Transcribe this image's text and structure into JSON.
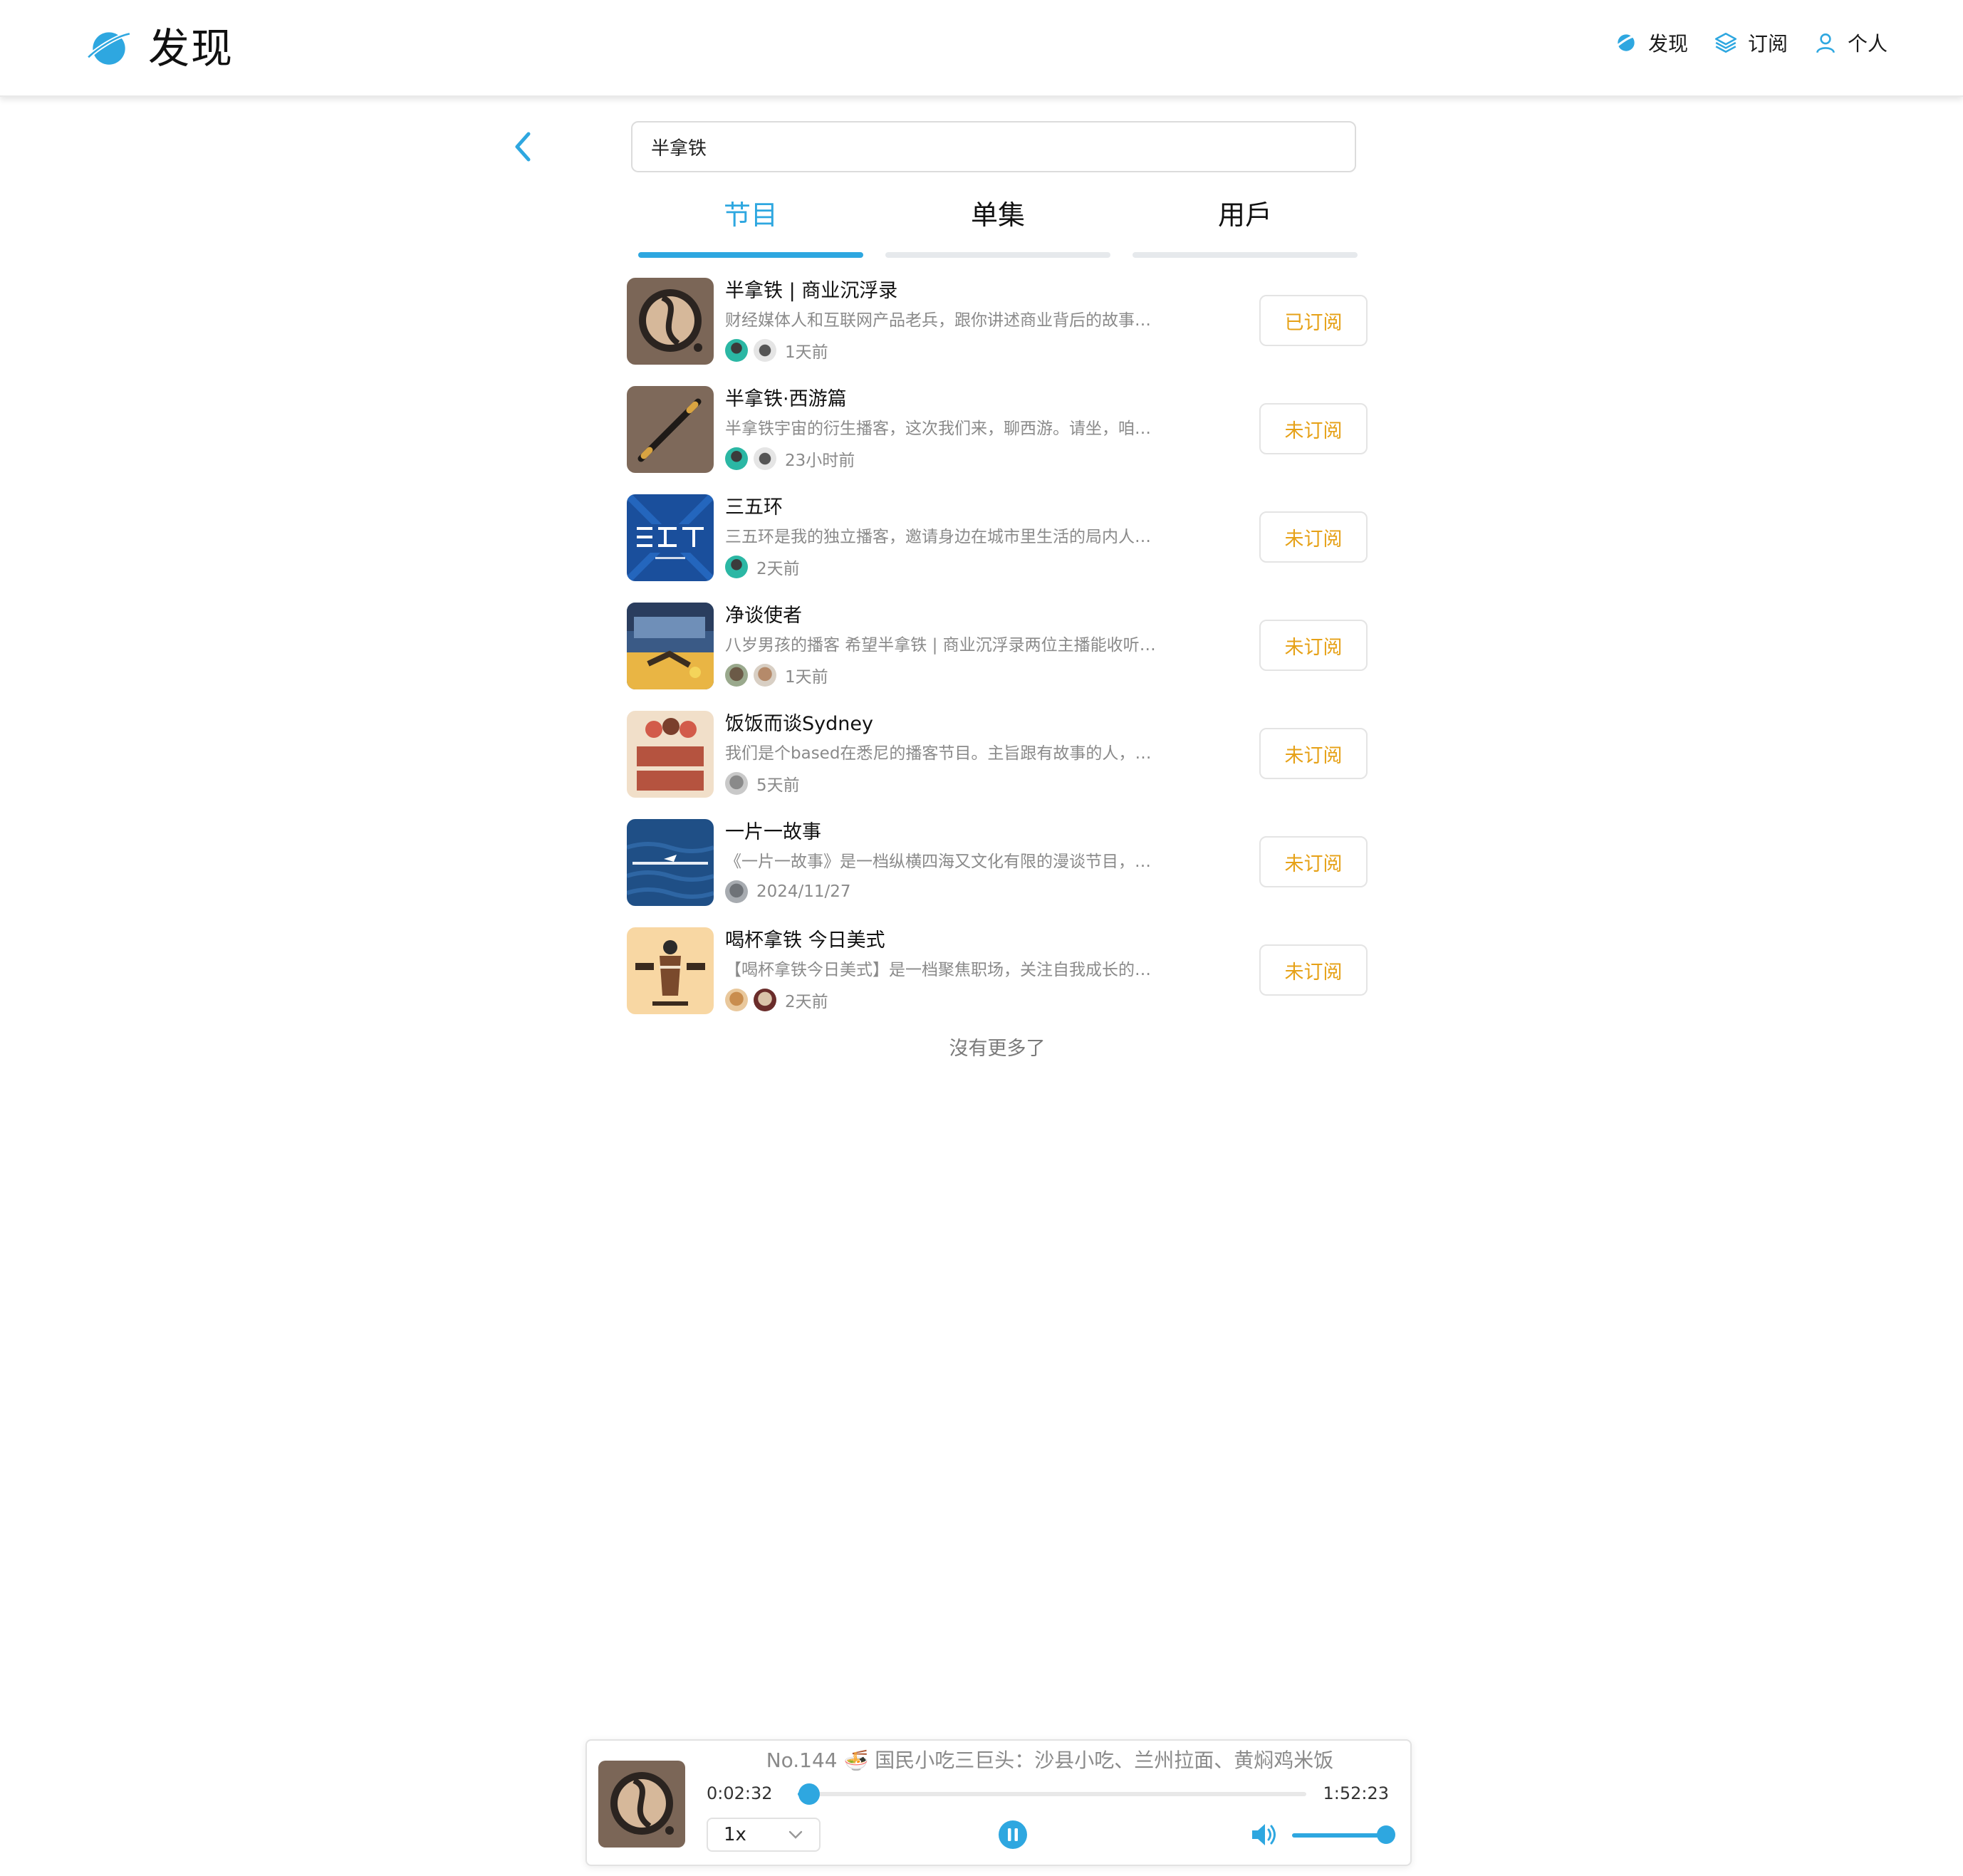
{
  "header": {
    "title": "发现",
    "nav": [
      {
        "label": "发现",
        "icon": "planet-icon"
      },
      {
        "label": "订阅",
        "icon": "layers-icon"
      },
      {
        "label": "个人",
        "icon": "user-icon"
      }
    ]
  },
  "search": {
    "value": "半拿铁"
  },
  "tabs": [
    {
      "label": "节目",
      "active": true
    },
    {
      "label": "单集",
      "active": false
    },
    {
      "label": "用戶",
      "active": false
    }
  ],
  "results": [
    {
      "title": "半拿铁 | 商业沉浮录",
      "desc": "财经媒体人和互联网产品老兵，跟你讲述商业背后的故事。 来杯半拿铁，听听商业沉浮录。",
      "time": "1天前",
      "button": "已订阅",
      "subscribed": true
    },
    {
      "title": "半拿铁·西游篇",
      "desc": "半拿铁宇宙的衍生播客，这次我们来，聊西游。请坐，咱们边喝边聊。",
      "time": "23小时前",
      "button": "未订阅",
      "subscribed": false
    },
    {
      "title": "三五环",
      "desc": "三五环是我的独立播客，邀请身边在城市里生活的局内人朋友聊天。",
      "time": "2天前",
      "button": "未订阅",
      "subscribed": false
    },
    {
      "title": "净谈使者",
      "desc": "八岁男孩的播客 希望半拿铁 | 商业沉浮录两位主播能收听 谢谢大家支持",
      "time": "1天前",
      "button": "未订阅",
      "subscribed": false
    },
    {
      "title": "饭饭而谈Sydney",
      "desc": "我们是个based在悉尼的播客节目。主旨跟有故事的人，聊有趣的故事。",
      "time": "5天前",
      "button": "未订阅",
      "subscribed": false
    },
    {
      "title": "一片一故事",
      "desc": "《一片一故事》是一档纵横四海又文化有限的漫谈节目，它可以从任何地方开始。",
      "time": "2024/11/27",
      "button": "未订阅",
      "subscribed": false
    },
    {
      "title": "喝杯拿铁 今日美式",
      "desc": "【喝杯拿铁今日美式】是一档聚焦职场，关注自我成长的播客栏目，欢迎收听。",
      "time": "2天前",
      "button": "未订阅",
      "subscribed": false
    }
  ],
  "footer_note": "沒有更多了",
  "player": {
    "episode_title": "No.144 🍜 国民小吃三巨头：沙县小吃、兰州拉面、黄焖鸡米饭",
    "current_time": "0:02:32",
    "total_time": "1:52:23",
    "progress": 0.022,
    "speed": "1x",
    "volume": 1.0,
    "state": "playing"
  },
  "colors": {
    "accent": "#2ea7e0",
    "subscribe_text": "#e6a117",
    "muted_text": "#8a8a8a"
  }
}
